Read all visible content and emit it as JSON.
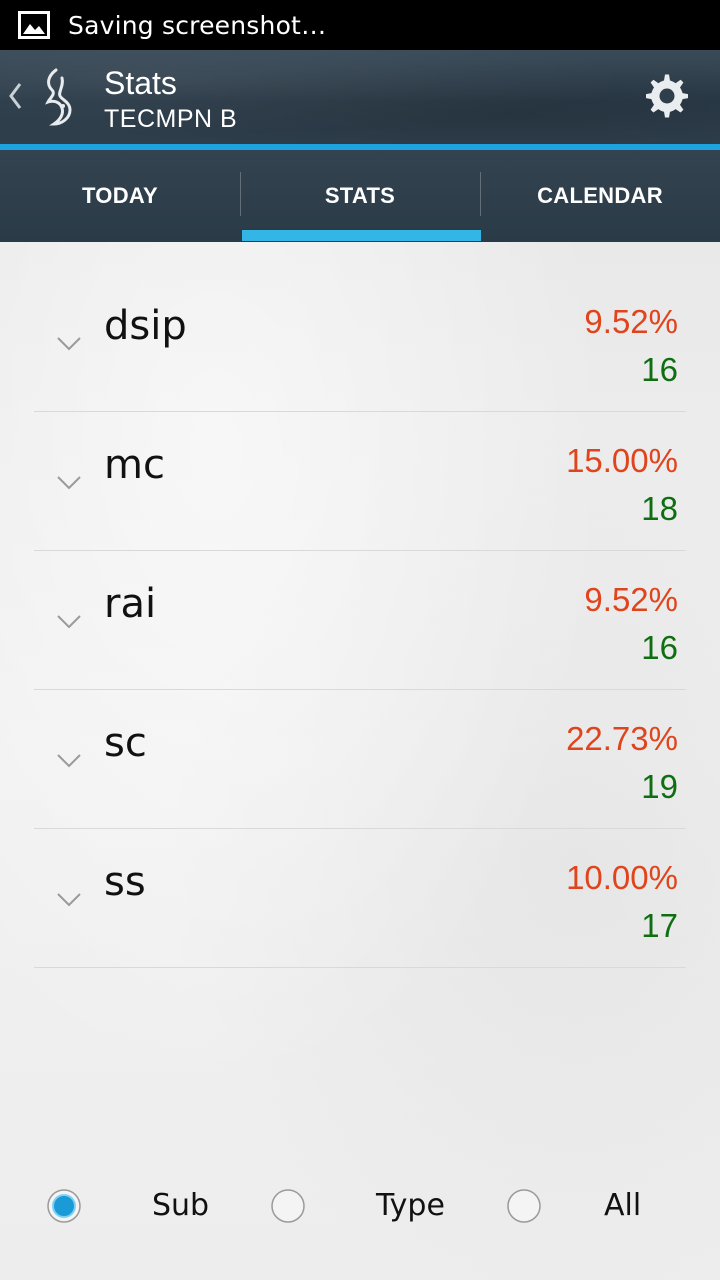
{
  "status_bar": {
    "text": "Saving screenshot…",
    "icon": "image-icon"
  },
  "action_bar": {
    "title": "Stats",
    "subtitle": "TECMPN B",
    "settings_icon": "gear-icon",
    "up_icon": "chevron-left-icon"
  },
  "tabs": [
    {
      "label": "TODAY"
    },
    {
      "label": "STATS",
      "selected": true
    },
    {
      "label": "CALENDAR"
    }
  ],
  "stats": [
    {
      "name": "dsip",
      "percent": "9.52%",
      "count": "16"
    },
    {
      "name": "mc",
      "percent": "15.00%",
      "count": "18"
    },
    {
      "name": "rai",
      "percent": "9.52%",
      "count": "16"
    },
    {
      "name": "sc",
      "percent": "22.73%",
      "count": "19"
    },
    {
      "name": "ss",
      "percent": "10.00%",
      "count": "17"
    }
  ],
  "filter": {
    "options": [
      {
        "label": "Sub",
        "checked": true
      },
      {
        "label": "Type",
        "checked": false
      },
      {
        "label": "All",
        "checked": false
      }
    ]
  },
  "colors": {
    "accent": "#33b5e5",
    "percent": "#e0441c",
    "count": "#0f6e12"
  }
}
